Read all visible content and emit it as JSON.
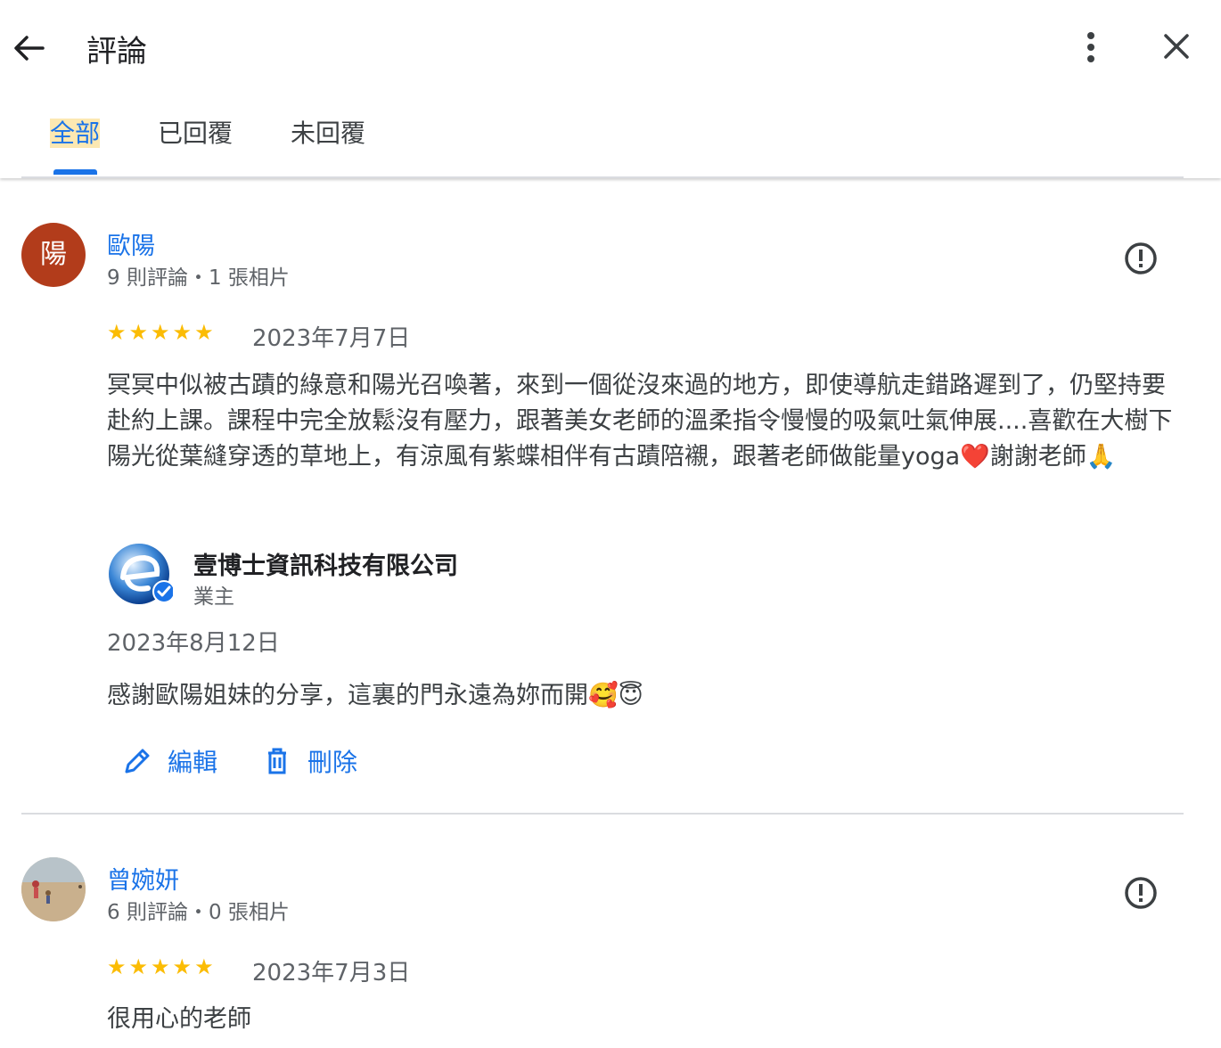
{
  "header": {
    "title": "評論"
  },
  "tabs": [
    {
      "label": "全部",
      "active": true
    },
    {
      "label": "已回覆",
      "active": false
    },
    {
      "label": "未回覆",
      "active": false
    }
  ],
  "reviews": [
    {
      "avatar_letter": "陽",
      "name": "歐陽",
      "meta": "9 則評論・1 張相片",
      "rating": 5,
      "stars": "★★★★★",
      "date": "2023年7月7日",
      "text": "冥冥中似被古蹟的綠意和陽光召喚著，來到一個從沒來過的地方，即使導航走錯路遲到了，仍堅持要赴約上課。課程中完全放鬆沒有壓力，跟著美女老師的溫柔指令慢慢的吸氣吐氣伸展....喜歡在大樹下陽光從葉縫穿透的草地上，有涼風有紫蝶相伴有古蹟陪襯，跟著老師做能量yoga❤️謝謝老師🙏",
      "reply": {
        "owner_name": "壹博士資訊科技有限公司",
        "owner_role": "業主",
        "date": "2023年8月12日",
        "text": "感謝歐陽姐妹的分享，這裏的門永遠為妳而開🥰😇",
        "edit_label": "編輯",
        "delete_label": "刪除"
      }
    },
    {
      "name": "曾婉妍",
      "meta": "6 則評論・0 張相片",
      "rating": 5,
      "stars": "★★★★★",
      "date": "2023年7月3日",
      "text": "很用心的老師"
    }
  ],
  "colors": {
    "accent": "#1a73e8",
    "star": "#fbbc04",
    "avatar_bg": "#b23c1b",
    "tab_highlight": "#fce8b2"
  }
}
